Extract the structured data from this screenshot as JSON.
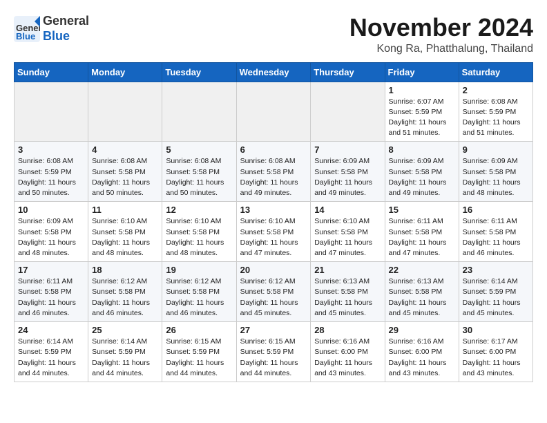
{
  "header": {
    "logo_general": "General",
    "logo_blue": "Blue",
    "month_title": "November 2024",
    "location": "Kong Ra, Phatthalung, Thailand"
  },
  "weekdays": [
    "Sunday",
    "Monday",
    "Tuesday",
    "Wednesday",
    "Thursday",
    "Friday",
    "Saturday"
  ],
  "weeks": [
    [
      {
        "day": "",
        "content": ""
      },
      {
        "day": "",
        "content": ""
      },
      {
        "day": "",
        "content": ""
      },
      {
        "day": "",
        "content": ""
      },
      {
        "day": "",
        "content": ""
      },
      {
        "day": "1",
        "content": "Sunrise: 6:07 AM\nSunset: 5:59 PM\nDaylight: 11 hours and 51 minutes."
      },
      {
        "day": "2",
        "content": "Sunrise: 6:08 AM\nSunset: 5:59 PM\nDaylight: 11 hours and 51 minutes."
      }
    ],
    [
      {
        "day": "3",
        "content": "Sunrise: 6:08 AM\nSunset: 5:59 PM\nDaylight: 11 hours and 50 minutes."
      },
      {
        "day": "4",
        "content": "Sunrise: 6:08 AM\nSunset: 5:58 PM\nDaylight: 11 hours and 50 minutes."
      },
      {
        "day": "5",
        "content": "Sunrise: 6:08 AM\nSunset: 5:58 PM\nDaylight: 11 hours and 50 minutes."
      },
      {
        "day": "6",
        "content": "Sunrise: 6:08 AM\nSunset: 5:58 PM\nDaylight: 11 hours and 49 minutes."
      },
      {
        "day": "7",
        "content": "Sunrise: 6:09 AM\nSunset: 5:58 PM\nDaylight: 11 hours and 49 minutes."
      },
      {
        "day": "8",
        "content": "Sunrise: 6:09 AM\nSunset: 5:58 PM\nDaylight: 11 hours and 49 minutes."
      },
      {
        "day": "9",
        "content": "Sunrise: 6:09 AM\nSunset: 5:58 PM\nDaylight: 11 hours and 48 minutes."
      }
    ],
    [
      {
        "day": "10",
        "content": "Sunrise: 6:09 AM\nSunset: 5:58 PM\nDaylight: 11 hours and 48 minutes."
      },
      {
        "day": "11",
        "content": "Sunrise: 6:10 AM\nSunset: 5:58 PM\nDaylight: 11 hours and 48 minutes."
      },
      {
        "day": "12",
        "content": "Sunrise: 6:10 AM\nSunset: 5:58 PM\nDaylight: 11 hours and 48 minutes."
      },
      {
        "day": "13",
        "content": "Sunrise: 6:10 AM\nSunset: 5:58 PM\nDaylight: 11 hours and 47 minutes."
      },
      {
        "day": "14",
        "content": "Sunrise: 6:10 AM\nSunset: 5:58 PM\nDaylight: 11 hours and 47 minutes."
      },
      {
        "day": "15",
        "content": "Sunrise: 6:11 AM\nSunset: 5:58 PM\nDaylight: 11 hours and 47 minutes."
      },
      {
        "day": "16",
        "content": "Sunrise: 6:11 AM\nSunset: 5:58 PM\nDaylight: 11 hours and 46 minutes."
      }
    ],
    [
      {
        "day": "17",
        "content": "Sunrise: 6:11 AM\nSunset: 5:58 PM\nDaylight: 11 hours and 46 minutes."
      },
      {
        "day": "18",
        "content": "Sunrise: 6:12 AM\nSunset: 5:58 PM\nDaylight: 11 hours and 46 minutes."
      },
      {
        "day": "19",
        "content": "Sunrise: 6:12 AM\nSunset: 5:58 PM\nDaylight: 11 hours and 46 minutes."
      },
      {
        "day": "20",
        "content": "Sunrise: 6:12 AM\nSunset: 5:58 PM\nDaylight: 11 hours and 45 minutes."
      },
      {
        "day": "21",
        "content": "Sunrise: 6:13 AM\nSunset: 5:58 PM\nDaylight: 11 hours and 45 minutes."
      },
      {
        "day": "22",
        "content": "Sunrise: 6:13 AM\nSunset: 5:58 PM\nDaylight: 11 hours and 45 minutes."
      },
      {
        "day": "23",
        "content": "Sunrise: 6:14 AM\nSunset: 5:59 PM\nDaylight: 11 hours and 45 minutes."
      }
    ],
    [
      {
        "day": "24",
        "content": "Sunrise: 6:14 AM\nSunset: 5:59 PM\nDaylight: 11 hours and 44 minutes."
      },
      {
        "day": "25",
        "content": "Sunrise: 6:14 AM\nSunset: 5:59 PM\nDaylight: 11 hours and 44 minutes."
      },
      {
        "day": "26",
        "content": "Sunrise: 6:15 AM\nSunset: 5:59 PM\nDaylight: 11 hours and 44 minutes."
      },
      {
        "day": "27",
        "content": "Sunrise: 6:15 AM\nSunset: 5:59 PM\nDaylight: 11 hours and 44 minutes."
      },
      {
        "day": "28",
        "content": "Sunrise: 6:16 AM\nSunset: 6:00 PM\nDaylight: 11 hours and 43 minutes."
      },
      {
        "day": "29",
        "content": "Sunrise: 6:16 AM\nSunset: 6:00 PM\nDaylight: 11 hours and 43 minutes."
      },
      {
        "day": "30",
        "content": "Sunrise: 6:17 AM\nSunset: 6:00 PM\nDaylight: 11 hours and 43 minutes."
      }
    ]
  ]
}
